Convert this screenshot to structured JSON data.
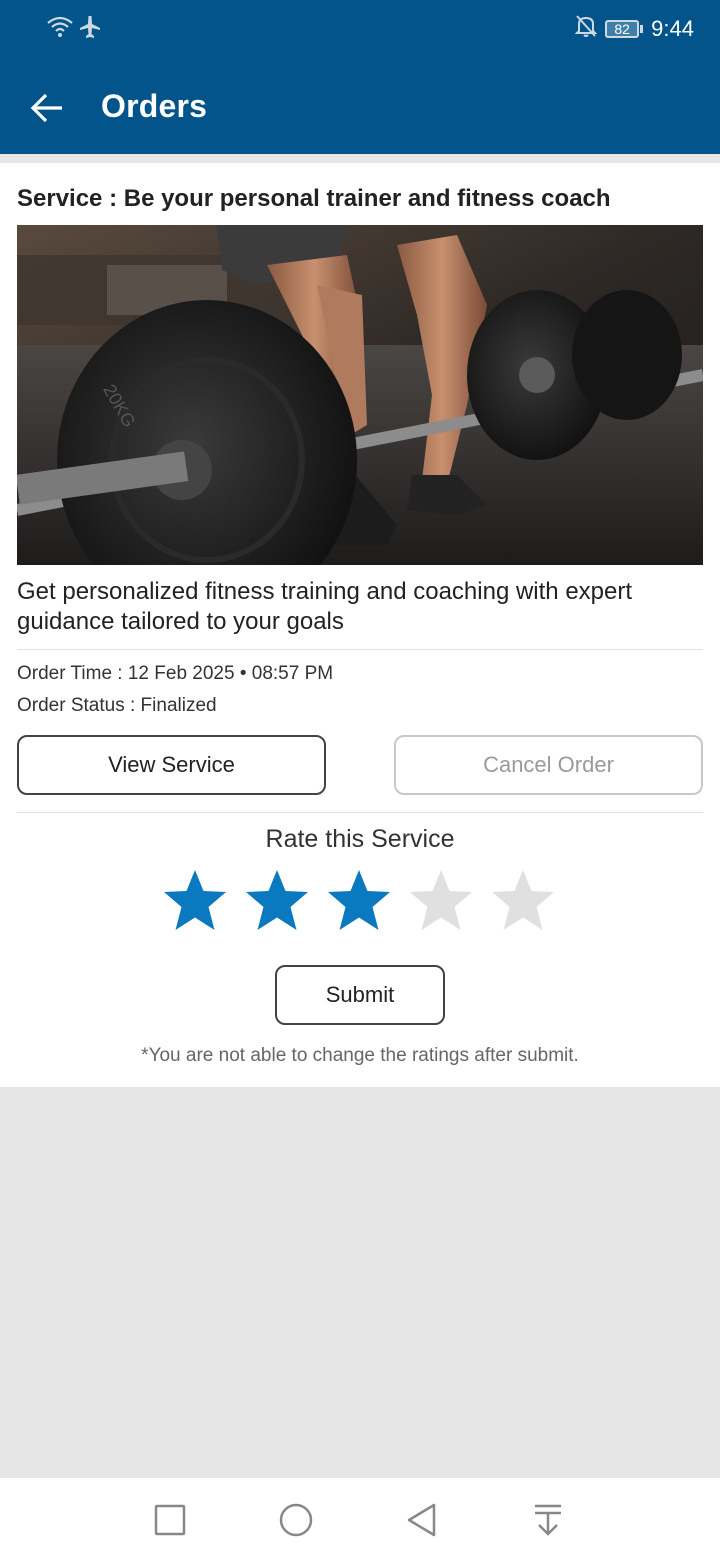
{
  "status_bar": {
    "time": "9:44",
    "battery": "82",
    "icons": [
      "wifi-icon",
      "airplane-icon",
      "notifications-off-icon",
      "battery-icon"
    ]
  },
  "app_bar": {
    "title": "Orders",
    "back_icon": "arrow-back-icon"
  },
  "order": {
    "service_title": "Service : Be your personal trainer and fitness coach",
    "image_description": "",
    "description": "Get personalized fitness training and coaching with expert guidance tailored to your goals",
    "order_time": "Order Time : 12 Feb 2025 • 08:57 PM",
    "order_status": "Order Status :  Finalized",
    "view_service_label": "View Service",
    "cancel_order_label": "Cancel Order"
  },
  "rating": {
    "label": "Rate this Service",
    "value": 3,
    "max": 5,
    "filled_color": "#0a79c0",
    "empty_color": "#e0e0e0",
    "submit_label": "Submit",
    "note": "*You are not able to change the ratings after submit."
  },
  "nav_bar": {
    "icons": [
      "recent-apps-icon",
      "home-icon",
      "back-icon",
      "notification-pull-icon"
    ]
  },
  "colors": {
    "header": "#02548a",
    "page_bg": "#e6e6e6"
  }
}
